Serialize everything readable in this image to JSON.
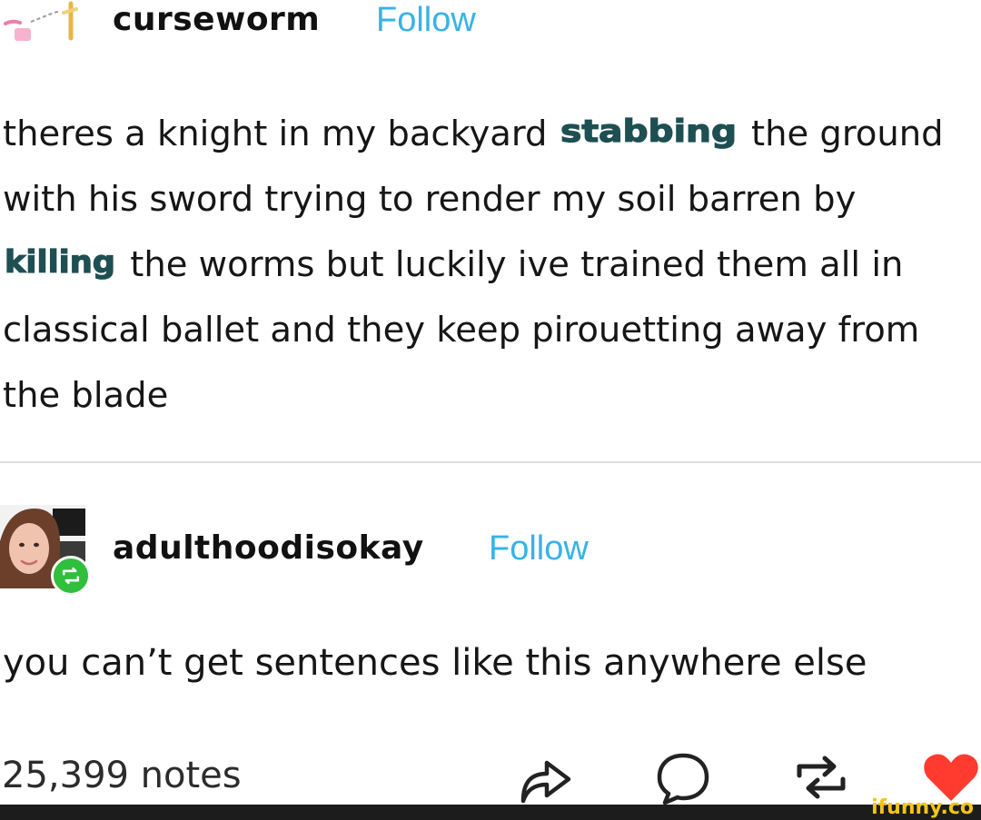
{
  "post": {
    "author": "curseworm",
    "follow_label": "Follow",
    "text_before_1": "theres a knight in my backyard ",
    "stylized_word_1": "stabbing",
    "text_after_1": " the ground with his sword trying to render my soil barren by ",
    "stylized_word_2": "killing",
    "text_after_2": " the worms but luckily ive trained them all in classical ballet and they keep pirouetting away from the blade"
  },
  "reblog": {
    "author": "adulthoodisokay",
    "follow_label": "Follow",
    "text": "you can’t get sentences like this anywhere else"
  },
  "footer": {
    "notes": "25,399 notes",
    "actions": [
      "share-icon",
      "comment-icon",
      "reblog-icon",
      "heart-icon"
    ]
  },
  "watermark": "ifunny.co",
  "colors": {
    "follow": "#35b3e8",
    "stylized_word": "#1e4f52",
    "reblog_badge": "#2fbf3c",
    "heart": "#ff3b2f",
    "watermark": "#f4c514"
  }
}
